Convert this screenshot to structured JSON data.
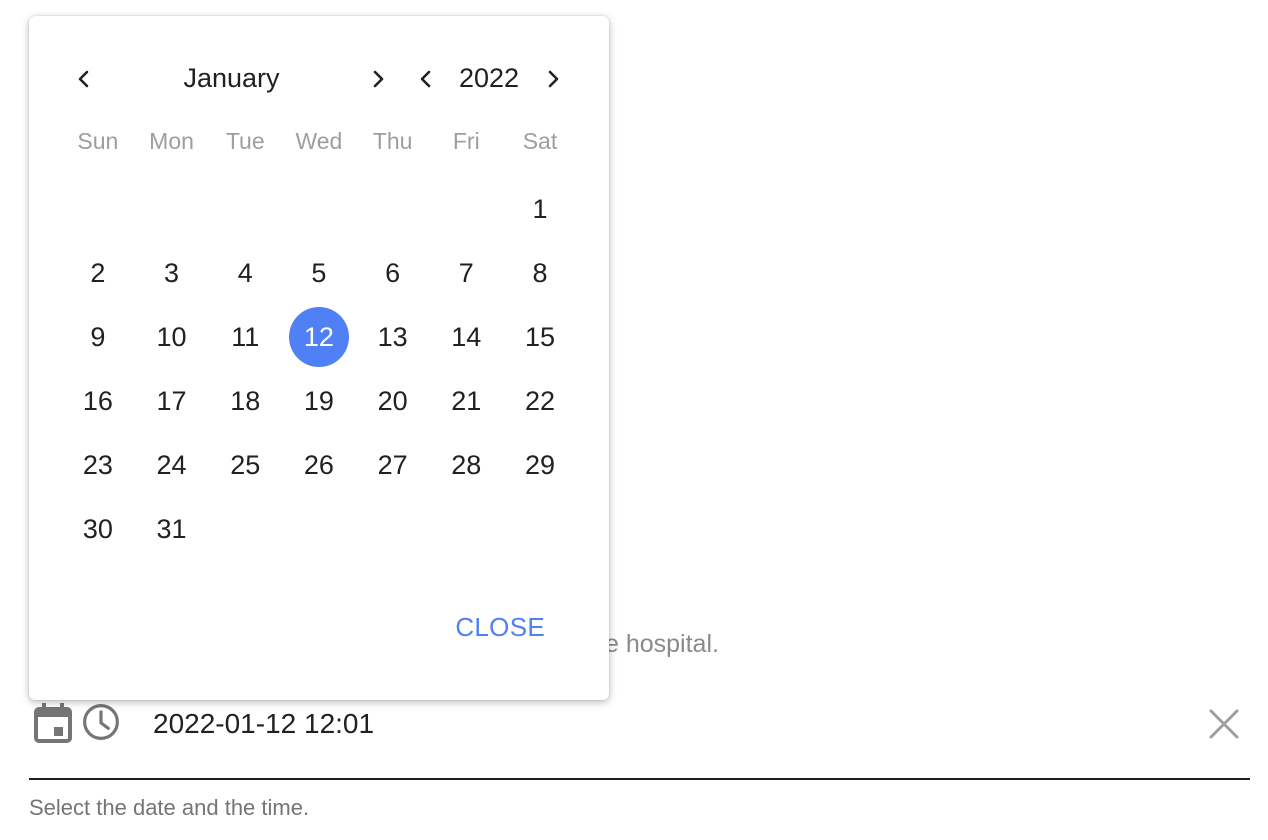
{
  "background": {
    "question_fragment": "e hospital."
  },
  "picker": {
    "month": "January",
    "year": "2022",
    "weekdays": [
      "Sun",
      "Mon",
      "Tue",
      "Wed",
      "Thu",
      "Fri",
      "Sat"
    ],
    "days": [
      "",
      "",
      "",
      "",
      "",
      "",
      "1",
      "2",
      "3",
      "4",
      "5",
      "6",
      "7",
      "8",
      "9",
      "10",
      "11",
      "12",
      "13",
      "14",
      "15",
      "16",
      "17",
      "18",
      "19",
      "20",
      "21",
      "22",
      "23",
      "24",
      "25",
      "26",
      "27",
      "28",
      "29",
      "30",
      "31"
    ],
    "selected_day": "12",
    "close_label": "CLOSE",
    "accent_color": "#4f80f5"
  },
  "field": {
    "value": "2022-01-12 12:01",
    "helper": "Select the date and the time.",
    "icons": [
      "calendar-icon",
      "clock-icon",
      "clear-icon"
    ]
  }
}
